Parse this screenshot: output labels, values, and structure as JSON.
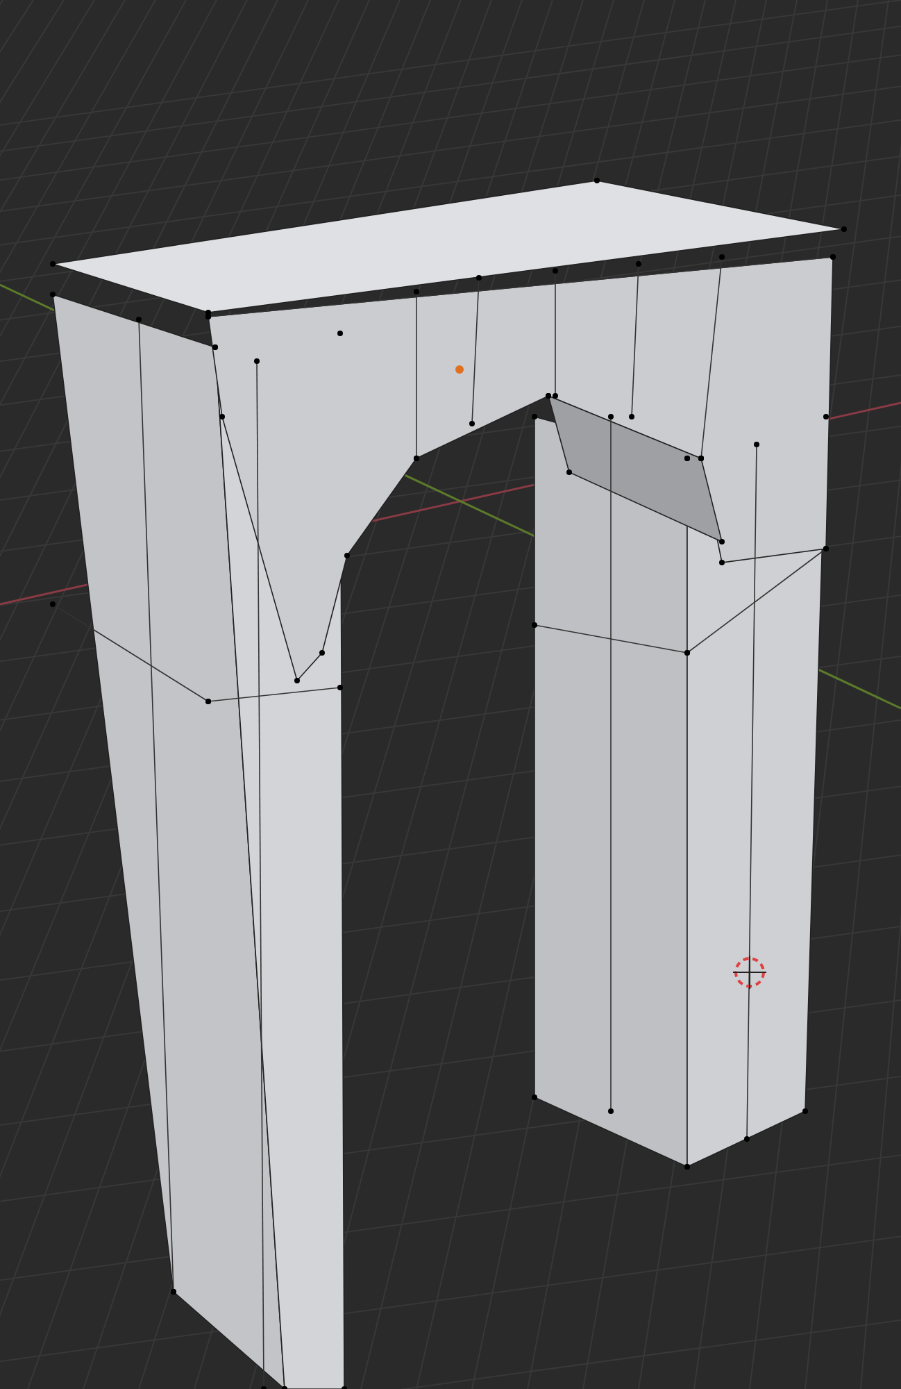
{
  "viewport": {
    "show_grid": true,
    "show_axes": true,
    "edit_mode": true,
    "show_origin": true,
    "show_3d_cursor": true
  }
}
